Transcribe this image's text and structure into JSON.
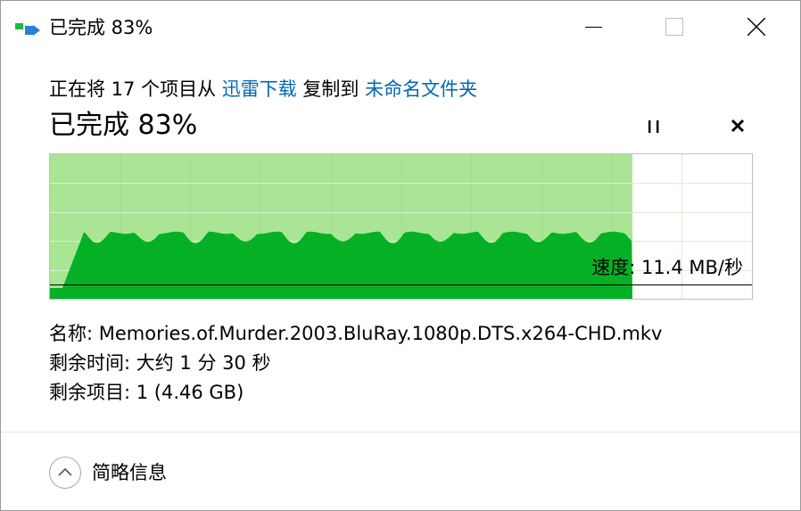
{
  "window": {
    "title": "已完成 83%",
    "icons": {
      "app": "copy-arrow-icon",
      "minimize": "minimize-icon",
      "maximize": "maximize-icon",
      "close": "close-icon"
    }
  },
  "copy": {
    "prefix": "正在将 17 个项目从 ",
    "source": "迅雷下载",
    "middle": " 复制到 ",
    "destination": "未命名文件夹"
  },
  "progress": {
    "label": "已完成 83%",
    "percent": 83,
    "pause_icon": "pause-icon",
    "cancel_icon": "cancel-icon"
  },
  "graph": {
    "speed_label": "速度: 11.4 MB/秒",
    "colors": {
      "fill": "#06b025",
      "background_done": "#a9e595",
      "grid": "#d9eed3",
      "line": "#000000"
    }
  },
  "details": {
    "name": "名称:  Memories.of.Murder.2003.BluRay.1080p.DTS.x264-CHD.mkv",
    "time_left": "剩余时间:  大约 1 分 30 秒",
    "items_left": "剩余项目:  1 (4.46 GB)"
  },
  "footer": {
    "less_details": "简略信息",
    "less_icon": "chevron-up-icon"
  }
}
